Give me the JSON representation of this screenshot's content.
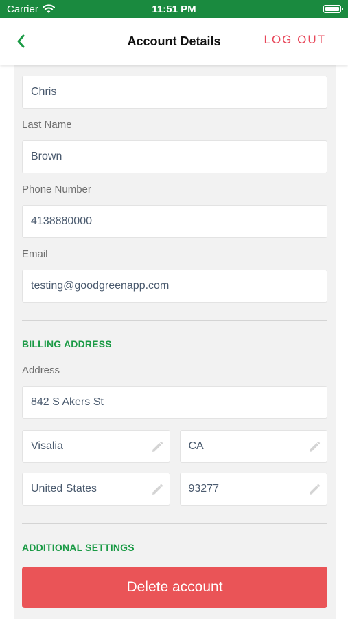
{
  "status_bar": {
    "carrier": "Carrier",
    "time": "11:51 PM"
  },
  "nav": {
    "title": "Account Details",
    "logout_label": "LOG OUT"
  },
  "form": {
    "first_name_value": "Chris",
    "last_name_label": "Last Name",
    "last_name_value": "Brown",
    "phone_label": "Phone Number",
    "phone_value": "4138880000",
    "email_label": "Email",
    "email_value": "testing@goodgreenapp.com"
  },
  "billing": {
    "section_title": "BILLING ADDRESS",
    "address_label": "Address",
    "address_value": "842 S Akers St",
    "city_value": "Visalia",
    "state_value": "CA",
    "country_value": "United States",
    "zip_value": "93277"
  },
  "additional": {
    "section_title": "ADDITIONAL SETTINGS",
    "delete_label": "Delete account"
  },
  "colors": {
    "brand_green": "#1a8a3f",
    "section_green": "#1a9a45",
    "logout_red": "#e8475a",
    "delete_red": "#ea5457"
  }
}
